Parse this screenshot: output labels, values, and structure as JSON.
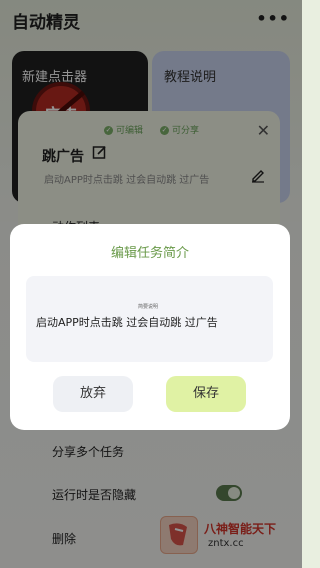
{
  "app": {
    "title": "自动精灵",
    "more_glyph": "•••",
    "cards": {
      "new_clicker": "新建点击器",
      "tutorial": "教程说明"
    },
    "ad_badge_text": "广告",
    "task": {
      "chip_editable": "可编辑",
      "chip_shareable": "可分享",
      "close_glyph": "✕",
      "title": "跳广告",
      "description": "启动APP时点击跳 过会自动跳 过广告"
    },
    "list": {
      "partial_row": "动作列表",
      "share_multiple": "分享多个任务",
      "hide_when_running": "运行时是否隐藏",
      "delete": "删除"
    },
    "toggle_on": true
  },
  "dialog": {
    "title": "编辑任务简介",
    "tiny_label": "简要说明",
    "input_value": "启动APP时点击跳 过会自动跳 过广告",
    "cancel_label": "放弃",
    "save_label": "保存"
  },
  "watermark": {
    "line1": "八神智能天下",
    "line2": "zntx.cc"
  },
  "colors": {
    "accent_green": "#6a9a4a",
    "save_button_bg": "#e0f2a4"
  },
  "icons": [
    "more-icon",
    "no-ads-icon",
    "check-icon",
    "close-icon",
    "edit-icon",
    "pen-icon",
    "toggle-icon"
  ]
}
